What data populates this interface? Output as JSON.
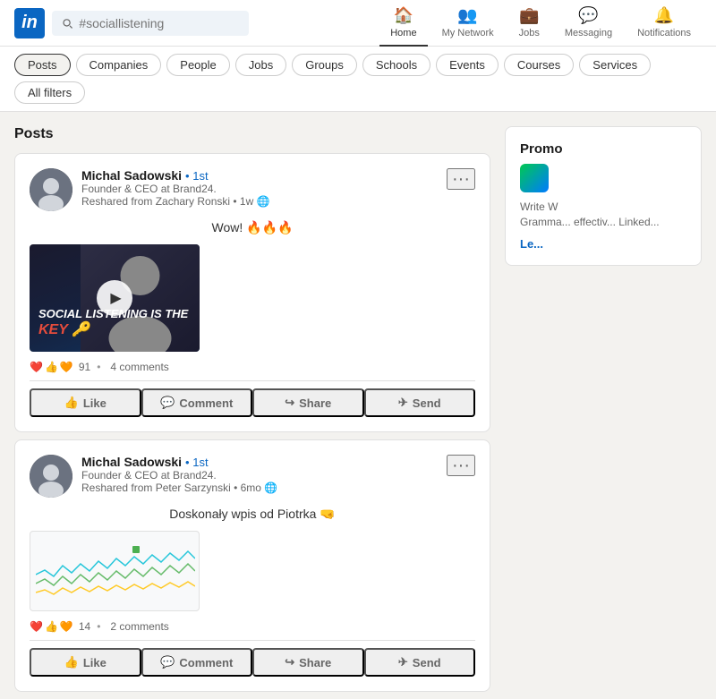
{
  "header": {
    "logo_text": "in",
    "search_placeholder": "#sociallistening",
    "nav": [
      {
        "id": "home",
        "label": "Home",
        "icon": "🏠"
      },
      {
        "id": "my-network",
        "label": "My Network",
        "icon": "👥"
      },
      {
        "id": "jobs",
        "label": "Jobs",
        "icon": "💼"
      },
      {
        "id": "messaging",
        "label": "Messaging",
        "icon": "💬"
      },
      {
        "id": "notifications",
        "label": "Notifications",
        "icon": "🔔"
      }
    ]
  },
  "filters": {
    "items": [
      "Posts",
      "Companies",
      "People",
      "Jobs",
      "Groups",
      "Schools",
      "Events",
      "Courses",
      "Services",
      "All filters"
    ]
  },
  "posts_section": {
    "title": "Posts"
  },
  "post1": {
    "author_name": "Michal Sadowski",
    "author_badge": "• 1st",
    "author_title": "Founder & CEO at Brand24.",
    "reshare": "Reshared from Zachary Ronski • 1w",
    "text": "Wow! 🔥🔥🔥",
    "video_line1": "SOCIAL LISTENING IS THE",
    "video_line2": "KEY 🔑",
    "reactions_count": "91",
    "comments": "4 comments",
    "action_like": "Like",
    "action_comment": "Comment",
    "action_share": "Share",
    "action_send": "Send"
  },
  "post2": {
    "author_name": "Michal Sadowski",
    "author_badge": "• 1st",
    "author_title": "Founder & CEO at Brand24.",
    "reshare": "Reshared from Peter Sarzynski • 6mo",
    "text": "Doskonały wpis od Piotrka 🤜",
    "reactions_count": "14",
    "comments": "2 comments",
    "action_like": "Like",
    "action_comment": "Comment",
    "action_share": "Share",
    "action_send": "Send"
  },
  "sidebar": {
    "promo_label": "Promo",
    "promo_title": "Write W",
    "promo_body": "Gramma... effectiv... Linked...",
    "promo_link": "Le..."
  },
  "colors": {
    "linkedin_blue": "#0a66c2",
    "bg": "#f3f2ef"
  }
}
